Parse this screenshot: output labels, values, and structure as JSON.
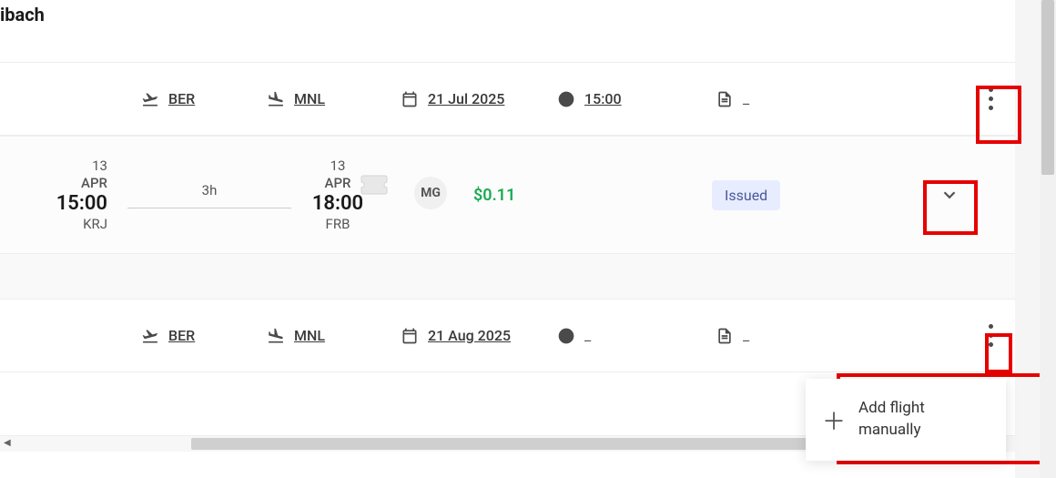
{
  "page_title_fragment": "ibach",
  "rows": [
    {
      "departure_code": "BER",
      "arrival_code": "MNL",
      "date": "21 Jul 2025",
      "time": "15:00",
      "doc": "_"
    },
    {
      "departure_code": "BER",
      "arrival_code": "MNL",
      "date": "21 Aug 2025",
      "time": "_",
      "doc": "_"
    }
  ],
  "flight_detail": {
    "dep_day": "13",
    "dep_mon": "APR",
    "dep_time": "15:00",
    "dep_code": "KRJ",
    "duration": "3h",
    "arr_day": "13",
    "arr_mon": "APR",
    "arr_time": "18:00",
    "arr_code": "FRB",
    "carrier": "MG",
    "price": "$0.11",
    "status": "Issued"
  },
  "popup": {
    "label": "Add flight manually"
  }
}
